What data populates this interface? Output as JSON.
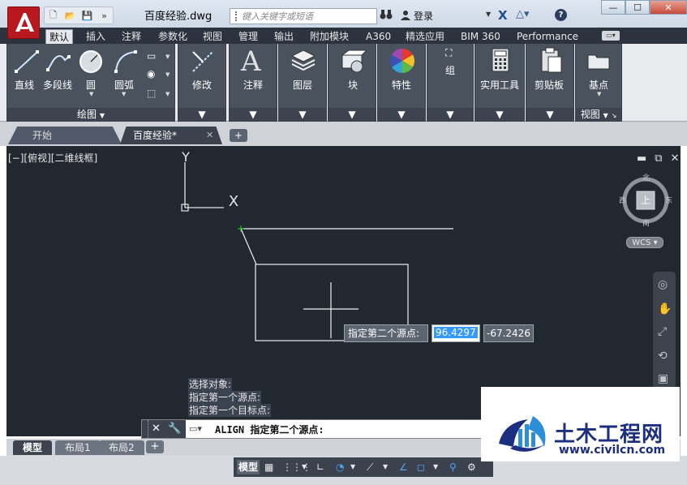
{
  "titlebar": {
    "doc_title": "百度经验.dwg",
    "search_placeholder": "键入关键字或短语",
    "login_label": "登录",
    "window_controls": [
      "—",
      "☐",
      "✕"
    ]
  },
  "ribbon_tabs": [
    "默认",
    "插入",
    "注释",
    "参数化",
    "视图",
    "管理",
    "输出",
    "附加模块",
    "A360",
    "精选应用",
    "BIM 360",
    "Performance"
  ],
  "ribbon": {
    "draw_panel": {
      "title": "绘图",
      "tools": [
        "直线",
        "多段线",
        "圆",
        "圆弧"
      ]
    },
    "modify_label": "修改",
    "annotation_label": "注释",
    "layers_label": "图层",
    "block_label": "块",
    "properties_label": "特性",
    "groups_label": "组",
    "utilities_label": "实用工具",
    "clipboard_label": "剪贴板",
    "base_label": "基点",
    "view_panel_title": "视图"
  },
  "file_tabs": {
    "start": "开始",
    "current": "百度经验*",
    "add": "+"
  },
  "canvas": {
    "view_label": "[−][俯视][二维线框]",
    "axis_y": "Y",
    "axis_x": "X",
    "viewcube": {
      "north": "北",
      "south": "南",
      "east": "东",
      "west": "西",
      "face": "上"
    },
    "wcs": "WCS",
    "dynamic_input": {
      "prompt": "指定第二个源点:",
      "x_value": "96.4297",
      "y_value": "-67.2426"
    },
    "command_history": [
      "选择对象:",
      "指定第一个源点:",
      "指定第一个目标点:"
    ]
  },
  "command_line": {
    "text": "ALIGN 指定第二个源点:"
  },
  "layout_tabs": [
    "模型",
    "布局1",
    "布局2"
  ],
  "status_bar": {
    "model_label": "模型"
  },
  "watermark": {
    "title": "土木工程网",
    "url": "www.civilcn.com"
  },
  "colors": {
    "app_red": "#b9181e",
    "canvas_bg": "#212830",
    "panel_bg": "#4a525e",
    "accent_blue": "#3399ff",
    "watermark_blue": "#1b2e80"
  }
}
